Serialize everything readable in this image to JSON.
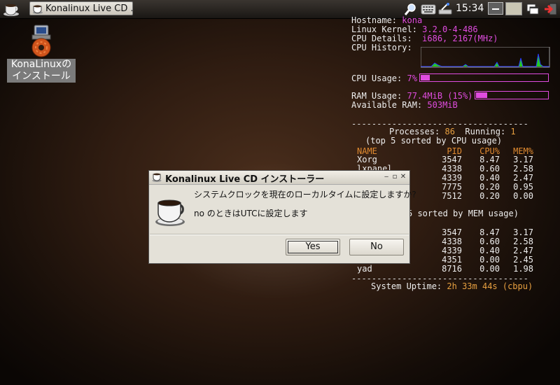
{
  "taskbar": {
    "task_label": "Konalinux Live CD ...",
    "clock": "15:34"
  },
  "desktop": {
    "icon_label_line1": "KonaLinuxの",
    "icon_label_line2": "インストール"
  },
  "conky": {
    "hostname_label": "Hostname:",
    "hostname": "kona",
    "kernel_label": "Linux Kernel:",
    "kernel": "3.2.0-4-486",
    "cpu_details_label": "CPU Details:",
    "cpu_details": "i686, 2167(MHz)",
    "cpu_history_label": "CPU History:",
    "cpu_usage_label": "CPU Usage:",
    "cpu_usage": "7%",
    "cpu_usage_fraction": 0.07,
    "ram_usage_label": "RAM Usage:",
    "ram_usage": "77.4MiB (15%)",
    "ram_usage_fraction": 0.15,
    "available_ram_label": "Available RAM:",
    "available_ram": "503MiB",
    "divider": "-----------------------------------",
    "processes_label": "Processes:",
    "processes": "86",
    "running_label": "Running:",
    "running": "1",
    "cpu_sort_caption": "(top 5 sorted by CPU usage)",
    "mem_sort_caption": "5 sorted by MEM usage)",
    "col_name": "NAME",
    "col_pid": "PID",
    "col_cpu": "CPU%",
    "col_mem": "MEM%",
    "cpu_rows": [
      {
        "name": "Xorg",
        "pid": "3547",
        "cpu": "8.47",
        "mem": "3.17"
      },
      {
        "name": "lxpanel",
        "pid": "4338",
        "cpu": "0.60",
        "mem": "2.58"
      },
      {
        "name": "",
        "pid": "4339",
        "cpu": "0.40",
        "mem": "2.47"
      },
      {
        "name": "",
        "pid": "7775",
        "cpu": "0.20",
        "mem": "0.95"
      },
      {
        "name": "",
        "pid": "7512",
        "cpu": "0.20",
        "mem": "0.00"
      }
    ],
    "mem_rows": [
      {
        "name": "",
        "pid": "3547",
        "cpu": "8.47",
        "mem": "3.17"
      },
      {
        "name": "",
        "pid": "4338",
        "cpu": "0.60",
        "mem": "2.58"
      },
      {
        "name": "",
        "pid": "4339",
        "cpu": "0.40",
        "mem": "2.47"
      },
      {
        "name": "",
        "pid": "4351",
        "cpu": "0.00",
        "mem": "2.45"
      },
      {
        "name": "yad",
        "pid": "8716",
        "cpu": "0.00",
        "mem": "1.98"
      }
    ],
    "uptime_label": "System Uptime:",
    "uptime": "2h 33m 44s (cbpu)"
  },
  "dialog": {
    "title": "Konalinux Live CD インストーラー",
    "question": "システムクロックを現在のローカルタイムに設定しますか?",
    "subtext": "no のときはUTCに設定します",
    "yes_label": "Yes",
    "no_label": "No"
  },
  "colors": {
    "conky_value": "#e04ce0",
    "conky_header": "#e08a30",
    "cpu_graph_blue": "#2a3cff",
    "cpu_graph_green": "#22cc22"
  }
}
